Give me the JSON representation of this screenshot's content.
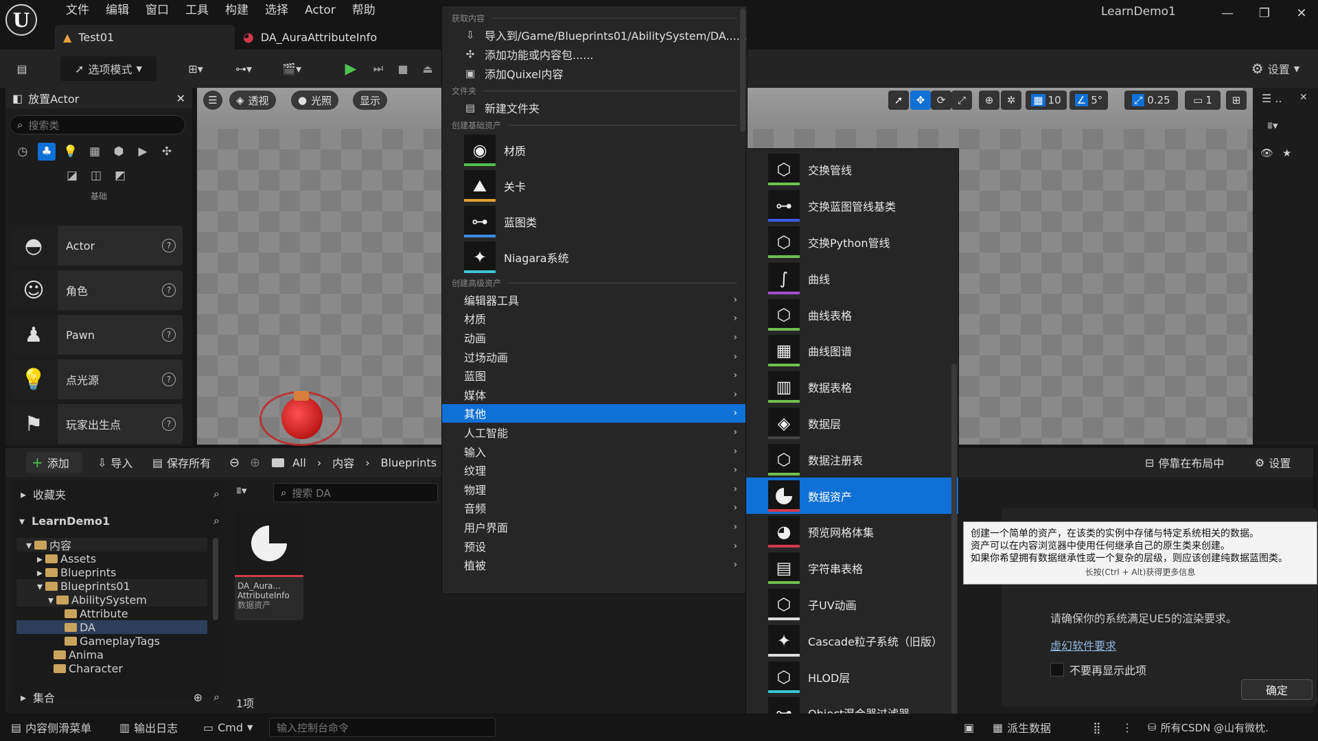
{
  "app": {
    "title": "LearnDemo1",
    "menu": [
      "文件",
      "编辑",
      "窗口",
      "工具",
      "构建",
      "选择",
      "Actor",
      "帮助"
    ],
    "tabs": [
      {
        "label": "Test01"
      },
      {
        "label": "DA_AuraAttributeInfo"
      }
    ]
  },
  "toolbar": {
    "mode_label": "选项模式",
    "settings_label": "设置"
  },
  "viewport": {
    "perspective": "透视",
    "lit": "光照",
    "show": "显示",
    "grid_size": "10",
    "rot_snap": "5°",
    "scale_snap": "0.25",
    "camera_speed": "1"
  },
  "place_actor": {
    "title": "放置Actor",
    "search_placeholder": "搜索类",
    "category_label": "基础",
    "items": [
      "Actor",
      "角色",
      "Pawn",
      "点光源",
      "玩家出生点"
    ]
  },
  "content_browser": {
    "add": "添加",
    "import": "导入",
    "save_all": "保存所有",
    "path": [
      "All",
      "内容",
      "Blueprints"
    ],
    "dock": "停靠在布局中",
    "settings": "设置",
    "favorites": "收藏夹",
    "project": "LearnDemo1",
    "collections": "集合",
    "search_placeholder": "搜索 DA",
    "item_count": "1项",
    "asset": {
      "name1": "DA_Aura...",
      "name2": "AttributeInfo",
      "type": "数据资产"
    },
    "tree": [
      {
        "label": "内容",
        "depth": 1
      },
      {
        "label": "Assets",
        "depth": 2
      },
      {
        "label": "Blueprints",
        "depth": 2
      },
      {
        "label": "Blueprints01",
        "depth": 2
      },
      {
        "label": "AbilitySystem",
        "depth": 3
      },
      {
        "label": "Attribute",
        "depth": 4
      },
      {
        "label": "DA",
        "depth": 4
      },
      {
        "label": "GameplayTags",
        "depth": 4
      },
      {
        "label": "Anima",
        "depth": 3
      },
      {
        "label": "Character",
        "depth": 3
      }
    ]
  },
  "context_menu": {
    "sections": {
      "get": "获取内容",
      "folder": "文件夹",
      "basic": "创建基础资产",
      "advanced": "创建高级资产"
    },
    "get_items": [
      "导入到/Game/Blueprints01/AbilitySystem/DA......",
      "添加功能或内容包......",
      "添加Quixel内容"
    ],
    "new_folder": "新建文件夹",
    "basic_assets": [
      "材质",
      "关卡",
      "蓝图类",
      "Niagara系统"
    ],
    "advanced_items": [
      "编辑器工具",
      "材质",
      "动画",
      "过场动画",
      "蓝图",
      "媒体",
      "其他",
      "人工智能",
      "输入",
      "纹理",
      "物理",
      "音频",
      "用户界面",
      "预设",
      "植被"
    ]
  },
  "submenu": {
    "items": [
      "交换管线",
      "交换蓝图管线基类",
      "交换Python管线",
      "曲线",
      "曲线表格",
      "曲线图谱",
      "数据表格",
      "数据层",
      "数据注册表",
      "数据资产",
      "预览网格体集",
      "字符串表格",
      "子UV动画",
      "Cascade粒子系统（旧版）",
      "HLOD层",
      "Object混合器过滤器"
    ]
  },
  "tooltip": {
    "line1": "创建一个简单的资产，在该类的实例中存储与特定系统相关的数据。",
    "line2": "资产可以在内容浏览器中使用任何继承自己的原生类来创建。",
    "line3": "如果你希望拥有数据继承性或一个复杂的层级，则应该创建纯数据蓝图类。",
    "hint": "长按(Ctrl + Alt)获得更多信息"
  },
  "notice": {
    "text": "请确保你的系统满足UE5的渲染要求。",
    "link": "虚幻软件要求",
    "checkbox": "不要再显示此项",
    "ok": "确定"
  },
  "statusbar": {
    "drawer": "内容侧滑菜单",
    "log": "输出日志",
    "cmd": "Cmd",
    "console_placeholder": "输入控制台命令",
    "derived": "派生数据",
    "source": "所有CSDN @山有微枕."
  }
}
